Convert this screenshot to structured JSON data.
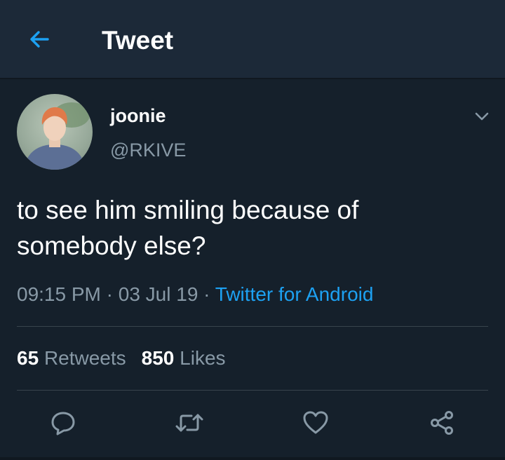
{
  "header": {
    "back_icon": "arrow-left-icon",
    "title": "Tweet",
    "accent_color": "#1da1f2"
  },
  "tweet": {
    "avatar_icon": "profile-photo",
    "display_name": "joonie",
    "handle": "@RKIVE",
    "menu_icon": "chevron-down-icon",
    "text_line1": "to see him smiling because of",
    "text_line2": "somebody else?",
    "time": "09:15 PM",
    "date": "03 Jul 19",
    "separator": "·",
    "source": "Twitter for Android"
  },
  "stats": {
    "retweets_count": "65",
    "retweets_label": "Retweets",
    "likes_count": "850",
    "likes_label": "Likes"
  },
  "actions": [
    {
      "icon": "reply-icon"
    },
    {
      "icon": "retweet-icon"
    },
    {
      "icon": "like-icon"
    },
    {
      "icon": "share-icon"
    }
  ],
  "theme": {
    "background": "#15202b",
    "header_background": "#1c2938",
    "secondary_text": "#8899a6",
    "divider": "#38444d"
  }
}
